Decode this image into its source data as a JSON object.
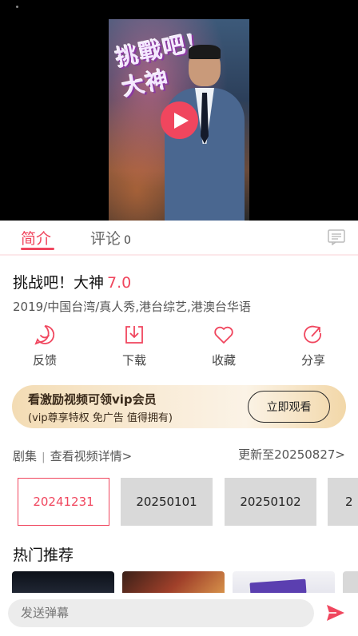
{
  "player": {
    "thumbnail_logo": "挑戰吧!大神"
  },
  "tabs": [
    {
      "label": "简介"
    },
    {
      "label": "评论",
      "count": "0"
    }
  ],
  "show": {
    "title": "挑战吧！大神",
    "score": "7.0",
    "meta": "2019/中国台湾/真人秀,港台综艺,港澳台华语"
  },
  "actions": [
    {
      "label": "反馈",
      "icon": "feedback-icon"
    },
    {
      "label": "下载",
      "icon": "download-icon"
    },
    {
      "label": "收藏",
      "icon": "heart-icon"
    },
    {
      "label": "分享",
      "icon": "share-icon"
    }
  ],
  "vip": {
    "title": "看激励视频可领vip会员",
    "subtitle": "(vip尊享特权 免广告 值得拥有)",
    "button": "立即观看"
  },
  "episodes": {
    "label": "剧集",
    "details_link": "查看视频详情>",
    "update": "更新至20250827>",
    "items": [
      "20241231",
      "20250101",
      "20250102",
      "2"
    ],
    "selected": "20241231"
  },
  "hot": {
    "title": "热门推荐"
  },
  "bottom": {
    "placeholder": "发送弹幕"
  },
  "colors": {
    "accent": "#f0465e"
  }
}
